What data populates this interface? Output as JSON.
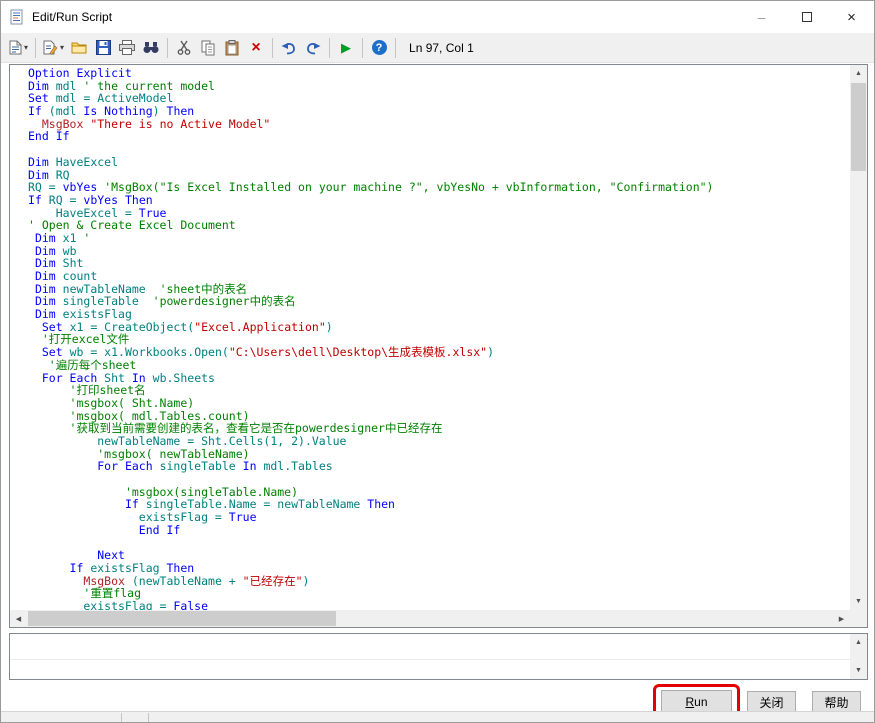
{
  "window": {
    "title": "Edit/Run Script"
  },
  "toolbar": {
    "status": "Ln 97, Col 1"
  },
  "icons": {
    "dropdown": "▾",
    "delete": "×",
    "run": "▶",
    "help": "?",
    "minimize": "–",
    "close": "×",
    "up": "▲",
    "down": "▼",
    "left": "◀",
    "right": "▶"
  },
  "colors": {
    "kw": "#0000ff",
    "id": "#008080",
    "cm": "#008000",
    "st": "#c00000",
    "fn": "#b22222",
    "del": "#d00000",
    "run": "#00a028",
    "annotation": "#e50000"
  },
  "buttons": {
    "run_accel": "R",
    "run_rest": "un",
    "close": "关闭",
    "help": "帮助"
  },
  "editor": {
    "lines": [
      [
        [
          "k",
          "Option Explicit"
        ]
      ],
      [
        [
          "k",
          "Dim"
        ],
        [
          "i",
          " mdl "
        ],
        [
          "c",
          "' the current model"
        ]
      ],
      [
        [
          "k",
          "Set"
        ],
        [
          "i",
          " mdl = ActiveModel"
        ]
      ],
      [
        [
          "k",
          "If"
        ],
        [
          "i",
          " (mdl "
        ],
        [
          "k",
          "Is Nothing"
        ],
        [
          "i",
          ") "
        ],
        [
          "k",
          "Then"
        ]
      ],
      [
        [
          "i",
          "  "
        ],
        [
          "f",
          "MsgBox "
        ],
        [
          "s",
          "\"There is no Active Model\""
        ]
      ],
      [
        [
          "k",
          "End If"
        ]
      ],
      [],
      [
        [
          "k",
          "Dim"
        ],
        [
          "i",
          " HaveExcel"
        ]
      ],
      [
        [
          "k",
          "Dim"
        ],
        [
          "i",
          " RQ"
        ]
      ],
      [
        [
          "i",
          "RQ = "
        ],
        [
          "k",
          "vbYes"
        ],
        [
          "i",
          " "
        ],
        [
          "c",
          "'MsgBox(\"Is Excel Installed on your machine ?\", vbYesNo + vbInformation, \"Confirmation\")"
        ]
      ],
      [
        [
          "k",
          "If"
        ],
        [
          "i",
          " RQ = "
        ],
        [
          "k",
          "vbYes"
        ],
        [
          "i",
          " "
        ],
        [
          "k",
          "Then"
        ]
      ],
      [
        [
          "i",
          "    HaveExcel = "
        ],
        [
          "k",
          "True"
        ]
      ],
      [
        [
          "c",
          "' Open & Create Excel Document"
        ]
      ],
      [
        [
          "i",
          " "
        ],
        [
          "k",
          "Dim"
        ],
        [
          "i",
          " x1 "
        ],
        [
          "c",
          "'"
        ]
      ],
      [
        [
          "i",
          " "
        ],
        [
          "k",
          "Dim"
        ],
        [
          "i",
          " wb"
        ]
      ],
      [
        [
          "i",
          " "
        ],
        [
          "k",
          "Dim"
        ],
        [
          "i",
          " Sht"
        ]
      ],
      [
        [
          "i",
          " "
        ],
        [
          "k",
          "Dim"
        ],
        [
          "i",
          " count"
        ]
      ],
      [
        [
          "i",
          " "
        ],
        [
          "k",
          "Dim"
        ],
        [
          "i",
          " newTableName  "
        ],
        [
          "c",
          "'sheet中的表名"
        ]
      ],
      [
        [
          "i",
          " "
        ],
        [
          "k",
          "Dim"
        ],
        [
          "i",
          " singleTable  "
        ],
        [
          "c",
          "'powerdesigner中的表名"
        ]
      ],
      [
        [
          "i",
          " "
        ],
        [
          "k",
          "Dim"
        ],
        [
          "i",
          " existsFlag"
        ]
      ],
      [
        [
          "i",
          "  "
        ],
        [
          "k",
          "Set"
        ],
        [
          "i",
          " x1 = CreateObject("
        ],
        [
          "s",
          "\"Excel.Application\""
        ],
        [
          "i",
          ")"
        ]
      ],
      [
        [
          "i",
          "  "
        ],
        [
          "c",
          "'打开excel文件"
        ]
      ],
      [
        [
          "i",
          "  "
        ],
        [
          "k",
          "Set"
        ],
        [
          "i",
          " wb = x1.Workbooks.Open("
        ],
        [
          "s",
          "\"C:\\Users\\dell\\Desktop\\生成表模板.xlsx\""
        ],
        [
          "i",
          ")"
        ]
      ],
      [
        [
          "i",
          "   "
        ],
        [
          "c",
          "'遍历每个sheet"
        ]
      ],
      [
        [
          "i",
          "  "
        ],
        [
          "k",
          "For Each"
        ],
        [
          "i",
          " Sht "
        ],
        [
          "k",
          "In"
        ],
        [
          "i",
          " wb.Sheets"
        ]
      ],
      [
        [
          "i",
          "      "
        ],
        [
          "c",
          "'打印sheet名"
        ]
      ],
      [
        [
          "i",
          "      "
        ],
        [
          "c",
          "'msgbox( Sht.Name)"
        ]
      ],
      [
        [
          "i",
          "      "
        ],
        [
          "c",
          "'msgbox( mdl.Tables.count)"
        ]
      ],
      [
        [
          "i",
          "      "
        ],
        [
          "c",
          "'获取到当前需要创建的表名，查看它是否在powerdesigner中已经存在"
        ]
      ],
      [
        [
          "i",
          "          newTableName = Sht.Cells(1, 2).Value"
        ]
      ],
      [
        [
          "i",
          "          "
        ],
        [
          "c",
          "'msgbox( newTableName)"
        ]
      ],
      [
        [
          "i",
          "          "
        ],
        [
          "k",
          "For Each"
        ],
        [
          "i",
          " singleTable "
        ],
        [
          "k",
          "In"
        ],
        [
          "i",
          " mdl.Tables"
        ]
      ],
      [],
      [
        [
          "i",
          "              "
        ],
        [
          "c",
          "'msgbox(singleTable.Name)"
        ]
      ],
      [
        [
          "i",
          "              "
        ],
        [
          "k",
          "If"
        ],
        [
          "i",
          " singleTable.Name = newTableName "
        ],
        [
          "k",
          "Then"
        ]
      ],
      [
        [
          "i",
          "                existsFlag = "
        ],
        [
          "k",
          "True"
        ]
      ],
      [
        [
          "i",
          "                "
        ],
        [
          "k",
          "End If"
        ]
      ],
      [],
      [
        [
          "i",
          "          "
        ],
        [
          "k",
          "Next"
        ]
      ],
      [
        [
          "i",
          "      "
        ],
        [
          "k",
          "If"
        ],
        [
          "i",
          " existsFlag "
        ],
        [
          "k",
          "Then"
        ]
      ],
      [
        [
          "i",
          "        "
        ],
        [
          "f",
          "MsgBox"
        ],
        [
          "i",
          " (newTableName + "
        ],
        [
          "s",
          "\"已经存在\""
        ],
        [
          "i",
          ")"
        ]
      ],
      [
        [
          "i",
          "        "
        ],
        [
          "c",
          "'重置flag"
        ]
      ],
      [
        [
          "i",
          "        existsFlag = "
        ],
        [
          "k",
          "False"
        ]
      ]
    ]
  }
}
